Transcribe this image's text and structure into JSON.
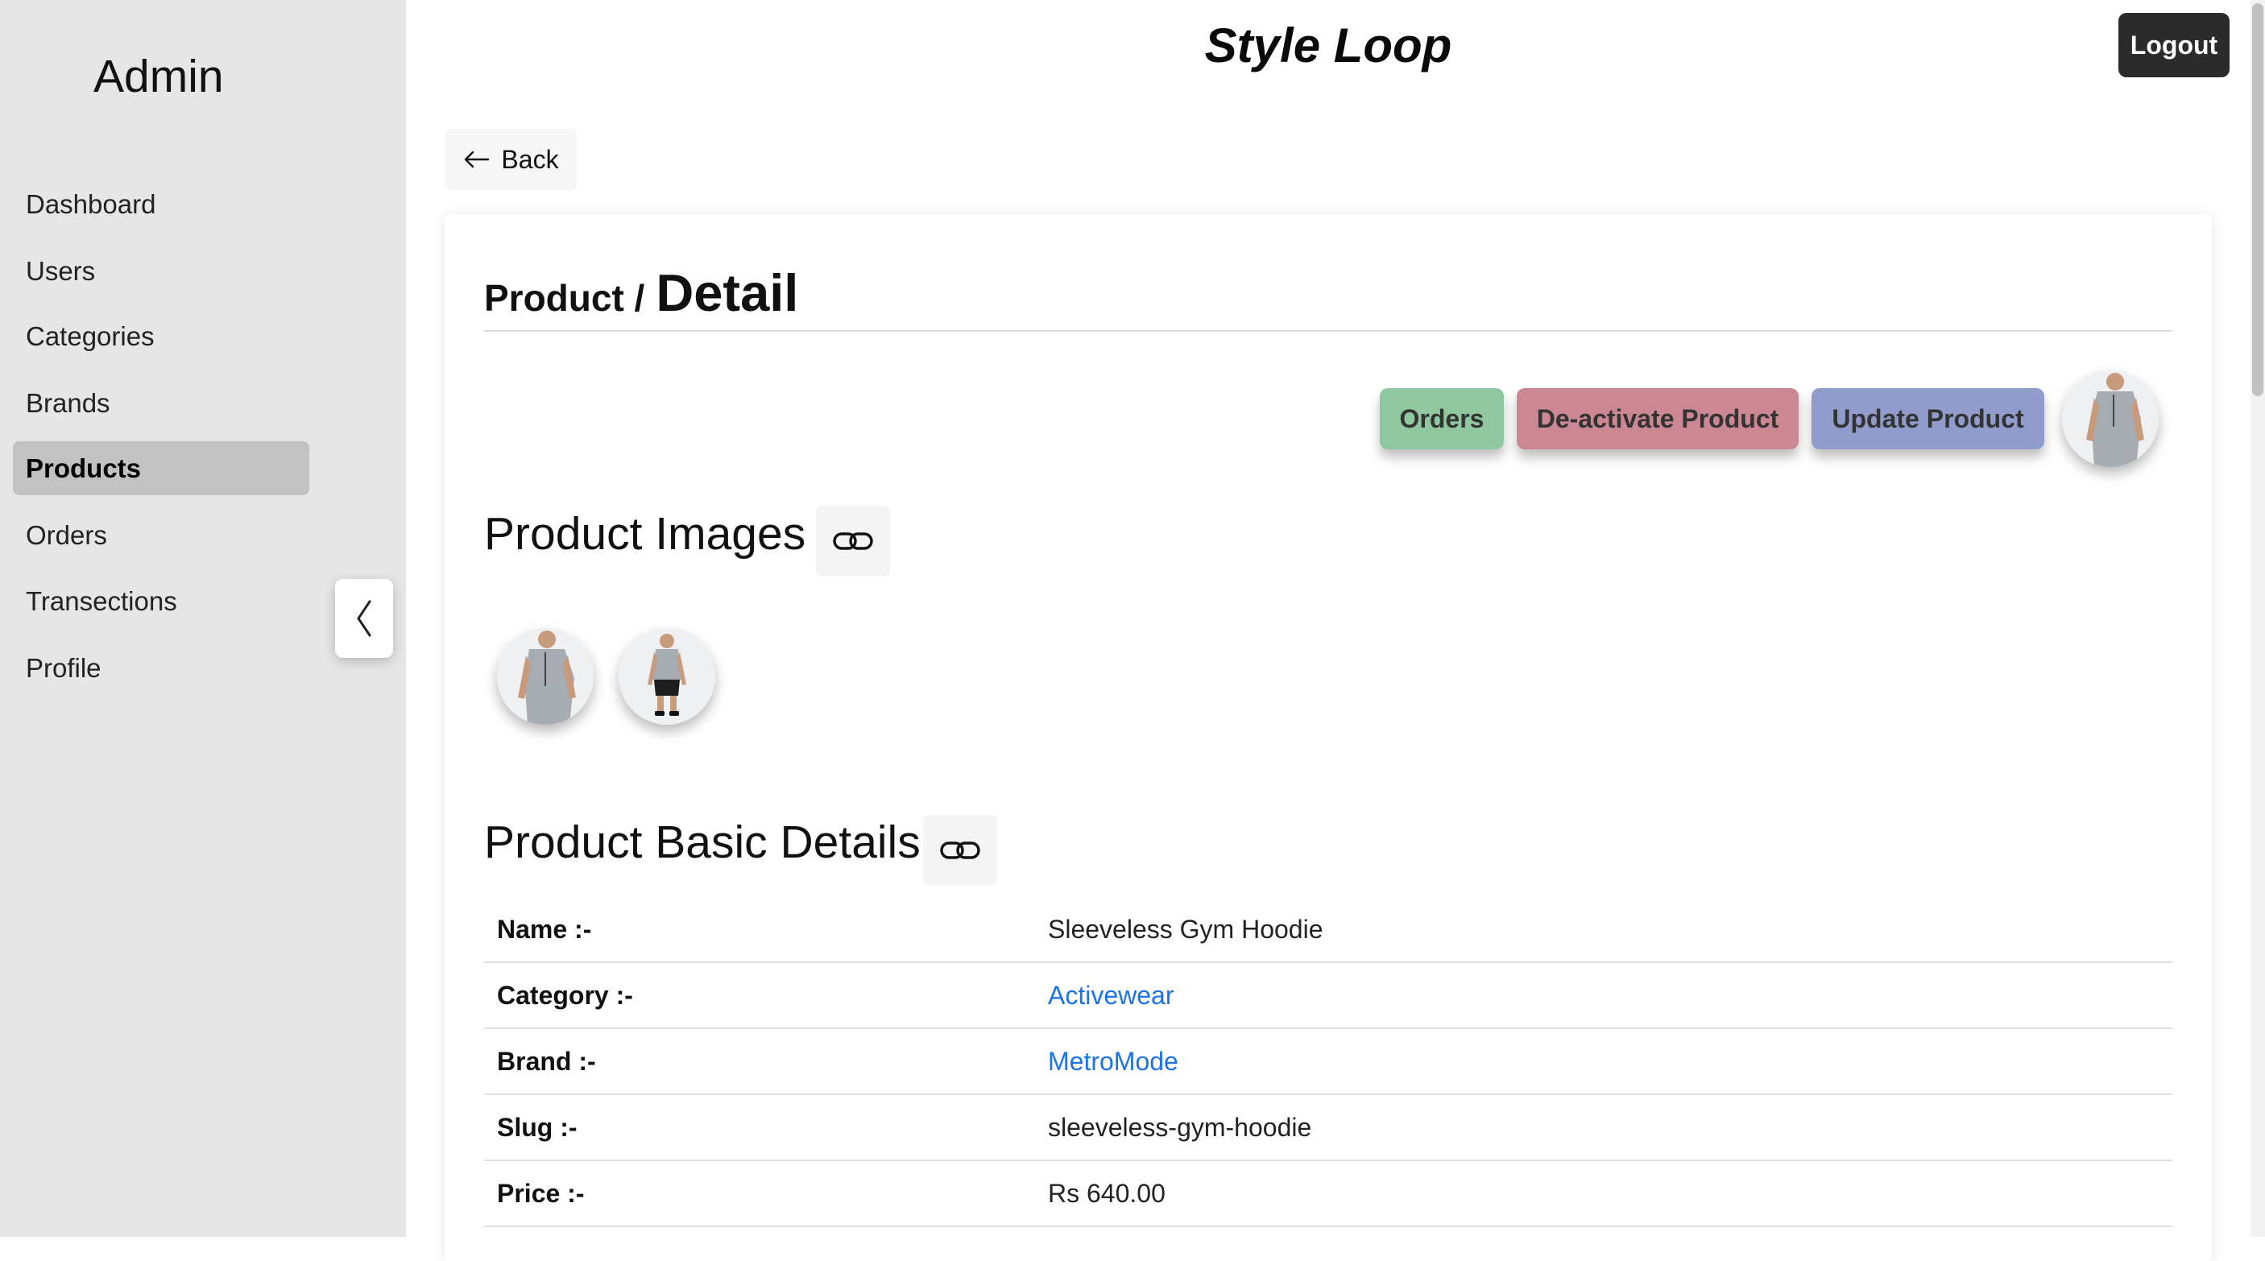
{
  "sidebar": {
    "title": "Admin",
    "items": [
      {
        "label": "Dashboard"
      },
      {
        "label": "Users"
      },
      {
        "label": "Categories"
      },
      {
        "label": "Brands"
      },
      {
        "label": "Products",
        "active": true
      },
      {
        "label": "Orders"
      },
      {
        "label": "Transections"
      },
      {
        "label": "Profile"
      }
    ],
    "collapse_icon": "chevron-left-icon"
  },
  "header": {
    "app_title": "Style Loop",
    "logout_label": "Logout"
  },
  "back": {
    "label": "Back",
    "icon": "arrow-left-icon"
  },
  "breadcrumb": {
    "parent": "Product /",
    "current": "Detail"
  },
  "actions": {
    "orders_label": "Orders",
    "deactivate_label": "De-activate Product",
    "update_label": "Update Product",
    "colors": {
      "orders": "#8fc89e",
      "deactivate": "#cc8795",
      "update": "#8f9ccc"
    }
  },
  "sections": {
    "images_title": "Product Images",
    "basic_title": "Product Basic Details",
    "link_icon": "link-icon"
  },
  "details": [
    {
      "label": "Name :-",
      "value": "Sleeveless Gym Hoodie",
      "link": false
    },
    {
      "label": "Category :-",
      "value": "Activewear",
      "link": true
    },
    {
      "label": "Brand :-",
      "value": "MetroMode",
      "link": true
    },
    {
      "label": "Slug :-",
      "value": "sleeveless-gym-hoodie",
      "link": false
    },
    {
      "label": "Price :-",
      "value": "Rs 640.00",
      "link": false
    }
  ]
}
